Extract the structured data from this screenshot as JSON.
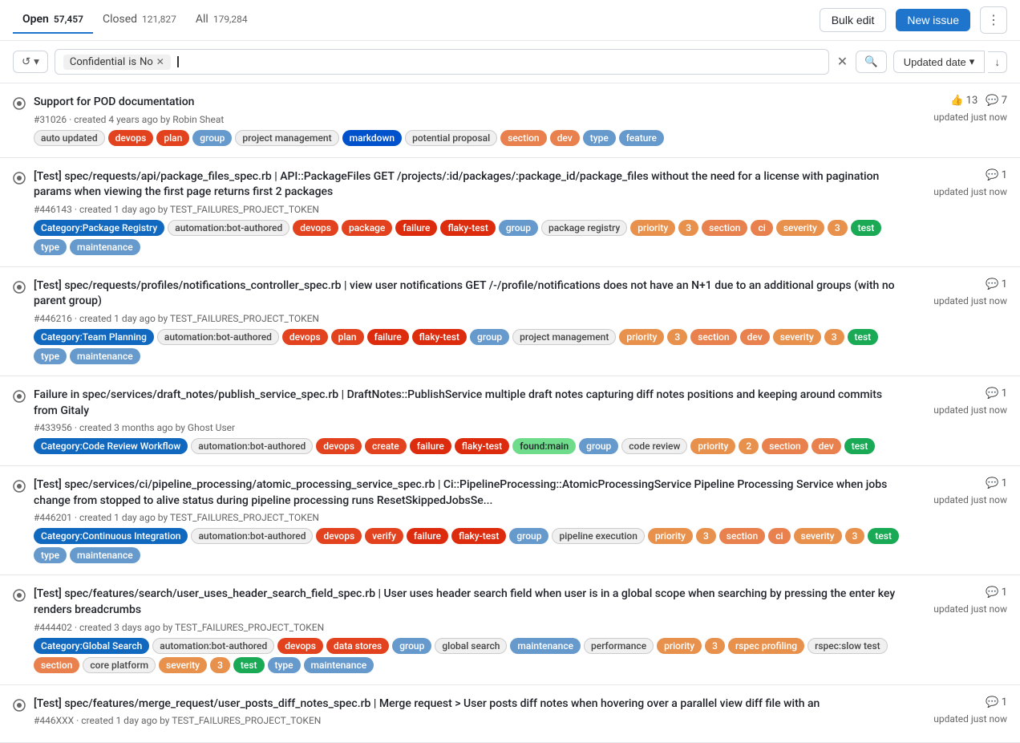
{
  "header": {
    "tabs": [
      {
        "id": "open",
        "label": "Open",
        "count": "57,457",
        "active": true
      },
      {
        "id": "closed",
        "label": "Closed",
        "count": "121,827",
        "active": false
      },
      {
        "id": "all",
        "label": "All",
        "count": "179,284",
        "active": false
      }
    ],
    "bulk_edit_label": "Bulk edit",
    "new_issue_label": "New issue",
    "more_icon": "⋮"
  },
  "filter_bar": {
    "history_icon": "↺",
    "filter_tag_field": "Confidential",
    "filter_tag_operator": "is",
    "filter_tag_value": "No",
    "sort_label": "Updated date",
    "sort_icon": "▼",
    "sort_order_icon": "↓"
  },
  "issues": [
    {
      "id": "issue-1",
      "number": "#31026",
      "title": "Support for POD documentation",
      "meta": "created 4 years ago by Robin Sheat",
      "reactions": [
        {
          "icon": "👍",
          "count": "13"
        },
        {
          "icon": "💬",
          "count": "7"
        }
      ],
      "updated": "updated just now",
      "labels": [
        {
          "text": "auto updated",
          "class": "lbl-auto-updated"
        },
        {
          "text": "devops",
          "class": "lbl-devops"
        },
        {
          "text": "plan",
          "class": "lbl-plan"
        },
        {
          "text": "group",
          "class": "lbl-group"
        },
        {
          "text": "project management",
          "class": "lbl-project-management"
        },
        {
          "text": "markdown",
          "class": "lbl-markdown"
        },
        {
          "text": "potential proposal",
          "class": "lbl-potential-proposal"
        },
        {
          "text": "section",
          "class": "lbl-section"
        },
        {
          "text": "dev",
          "class": "lbl-dev"
        },
        {
          "text": "type",
          "class": "lbl-type"
        },
        {
          "text": "feature",
          "class": "lbl-feature"
        }
      ]
    },
    {
      "id": "issue-2",
      "number": "#446143",
      "title": "[Test] spec/requests/api/package_files_spec.rb | API::PackageFiles GET /projects/:id/packages/:package_id/package_files without the need for a license with pagination params when viewing the first page returns first 2 packages",
      "meta": "created 1 day ago by TEST_FAILURES_PROJECT_TOKEN",
      "reactions": [
        {
          "icon": "💬",
          "count": "1"
        }
      ],
      "updated": "updated just now",
      "labels": [
        {
          "text": "Category:Package Registry",
          "class": "lbl-cat-package"
        },
        {
          "text": "automation:bot-authored",
          "class": "lbl-automation"
        },
        {
          "text": "devops",
          "class": "lbl-devops"
        },
        {
          "text": "package",
          "class": "lbl-package"
        },
        {
          "text": "failure",
          "class": "lbl-failure"
        },
        {
          "text": "flaky-test",
          "class": "lbl-flaky-test"
        },
        {
          "text": "group",
          "class": "lbl-group"
        },
        {
          "text": "package registry",
          "class": "lbl-package-registry"
        },
        {
          "text": "priority",
          "class": "lbl-priority"
        },
        {
          "text": "3",
          "class": "lbl-priority-num"
        },
        {
          "text": "section",
          "class": "lbl-section-ci"
        },
        {
          "text": "ci",
          "class": "lbl-section-ci"
        },
        {
          "text": "severity",
          "class": "lbl-severity"
        },
        {
          "text": "3",
          "class": "lbl-severity-num"
        },
        {
          "text": "test",
          "class": "lbl-test"
        },
        {
          "text": "type",
          "class": "lbl-type"
        },
        {
          "text": "maintenance",
          "class": "lbl-maintenance"
        }
      ]
    },
    {
      "id": "issue-3",
      "number": "#446216",
      "title": "[Test] spec/requests/profiles/notifications_controller_spec.rb | view user notifications GET /-/profile/notifications does not have an N+1 due to an additional groups (with no parent group)",
      "meta": "created 1 day ago by TEST_FAILURES_PROJECT_TOKEN",
      "reactions": [
        {
          "icon": "💬",
          "count": "1"
        }
      ],
      "updated": "updated just now",
      "labels": [
        {
          "text": "Category:Team Planning",
          "class": "lbl-cat-team"
        },
        {
          "text": "automation:bot-authored",
          "class": "lbl-automation"
        },
        {
          "text": "devops",
          "class": "lbl-devops"
        },
        {
          "text": "plan",
          "class": "lbl-plan"
        },
        {
          "text": "failure",
          "class": "lbl-failure"
        },
        {
          "text": "flaky-test",
          "class": "lbl-flaky-test"
        },
        {
          "text": "group",
          "class": "lbl-group"
        },
        {
          "text": "project management",
          "class": "lbl-project-management"
        },
        {
          "text": "priority",
          "class": "lbl-priority"
        },
        {
          "text": "3",
          "class": "lbl-priority-num"
        },
        {
          "text": "section",
          "class": "lbl-section"
        },
        {
          "text": "dev",
          "class": "lbl-dev"
        },
        {
          "text": "severity",
          "class": "lbl-severity"
        },
        {
          "text": "3",
          "class": "lbl-severity-num"
        },
        {
          "text": "test",
          "class": "lbl-test"
        },
        {
          "text": "type",
          "class": "lbl-type"
        },
        {
          "text": "maintenance",
          "class": "lbl-maintenance"
        }
      ]
    },
    {
      "id": "issue-4",
      "number": "#433956",
      "title": "Failure in spec/services/draft_notes/publish_service_spec.rb | DraftNotes::PublishService multiple draft notes capturing diff notes positions and keeping around commits from Gitaly",
      "meta": "created 3 months ago by Ghost User",
      "reactions": [
        {
          "icon": "💬",
          "count": "1"
        }
      ],
      "updated": "updated just now",
      "labels": [
        {
          "text": "Category:Code Review Workflow",
          "class": "lbl-cat-code-review"
        },
        {
          "text": "automation:bot-authored",
          "class": "lbl-automation"
        },
        {
          "text": "devops",
          "class": "lbl-devops"
        },
        {
          "text": "create",
          "class": "lbl-create"
        },
        {
          "text": "failure",
          "class": "lbl-failure"
        },
        {
          "text": "flaky-test",
          "class": "lbl-flaky-test"
        },
        {
          "text": "found:main",
          "class": "lbl-found-main"
        },
        {
          "text": "group",
          "class": "lbl-group"
        },
        {
          "text": "code review",
          "class": "lbl-code-review"
        },
        {
          "text": "priority",
          "class": "lbl-priority"
        },
        {
          "text": "2",
          "class": "lbl-priority-num"
        },
        {
          "text": "section",
          "class": "lbl-section"
        },
        {
          "text": "dev",
          "class": "lbl-dev"
        },
        {
          "text": "test",
          "class": "lbl-test"
        }
      ]
    },
    {
      "id": "issue-5",
      "number": "#446201",
      "title": "[Test] spec/services/ci/pipeline_processing/atomic_processing_service_spec.rb | Ci::PipelineProcessing::AtomicProcessingService Pipeline Processing Service when jobs change from stopped to alive status during pipeline processing runs ResetSkippedJobsSe...",
      "meta": "created 1 day ago by TEST_FAILURES_PROJECT_TOKEN",
      "reactions": [
        {
          "icon": "💬",
          "count": "1"
        }
      ],
      "updated": "updated just now",
      "labels": [
        {
          "text": "Category:Continuous Integration",
          "class": "lbl-cat-ci"
        },
        {
          "text": "automation:bot-authored",
          "class": "lbl-automation"
        },
        {
          "text": "devops",
          "class": "lbl-devops"
        },
        {
          "text": "verify",
          "class": "lbl-verify"
        },
        {
          "text": "failure",
          "class": "lbl-failure"
        },
        {
          "text": "flaky-test",
          "class": "lbl-flaky-test"
        },
        {
          "text": "group",
          "class": "lbl-group"
        },
        {
          "text": "pipeline execution",
          "class": "lbl-pipeline-execution"
        },
        {
          "text": "priority",
          "class": "lbl-priority"
        },
        {
          "text": "3",
          "class": "lbl-priority-num"
        },
        {
          "text": "section",
          "class": "lbl-section-ci"
        },
        {
          "text": "ci",
          "class": "lbl-section-ci"
        },
        {
          "text": "severity",
          "class": "lbl-severity"
        },
        {
          "text": "3",
          "class": "lbl-severity-num"
        },
        {
          "text": "test",
          "class": "lbl-test"
        },
        {
          "text": "type",
          "class": "lbl-type"
        },
        {
          "text": "maintenance",
          "class": "lbl-maintenance"
        }
      ]
    },
    {
      "id": "issue-6",
      "number": "#444402",
      "title": "[Test] spec/features/search/user_uses_header_search_field_spec.rb | User uses header search field when user is in a global scope when searching by pressing the enter key renders breadcrumbs",
      "meta": "created 3 days ago by TEST_FAILURES_PROJECT_TOKEN",
      "reactions": [
        {
          "icon": "💬",
          "count": "1"
        }
      ],
      "updated": "updated just now",
      "labels": [
        {
          "text": "Category:Global Search",
          "class": "lbl-cat-global"
        },
        {
          "text": "automation:bot-authored",
          "class": "lbl-automation"
        },
        {
          "text": "devops",
          "class": "lbl-devops"
        },
        {
          "text": "data stores",
          "class": "lbl-data-stores"
        },
        {
          "text": "group",
          "class": "lbl-group"
        },
        {
          "text": "global search",
          "class": "lbl-global-search"
        },
        {
          "text": "maintenance",
          "class": "lbl-maint"
        },
        {
          "text": "performance",
          "class": "lbl-performance"
        },
        {
          "text": "priority",
          "class": "lbl-priority"
        },
        {
          "text": "3",
          "class": "lbl-priority-num"
        },
        {
          "text": "rspec profiling",
          "class": "lbl-rspec-profiling"
        },
        {
          "text": "rspec:slow test",
          "class": "lbl-rspec-slow"
        },
        {
          "text": "section",
          "class": "lbl-section"
        },
        {
          "text": "core platform",
          "class": "lbl-core-platform"
        },
        {
          "text": "severity",
          "class": "lbl-severity"
        },
        {
          "text": "3",
          "class": "lbl-severity-num"
        },
        {
          "text": "test",
          "class": "lbl-test"
        },
        {
          "text": "type",
          "class": "lbl-type"
        },
        {
          "text": "maintenance",
          "class": "lbl-maintenance"
        }
      ]
    },
    {
      "id": "issue-7",
      "number": "#446XXX",
      "title": "[Test] spec/features/merge_request/user_posts_diff_notes_spec.rb | Merge request > User posts diff notes when hovering over a parallel view diff file with an",
      "meta": "created 1 day ago by TEST_FAILURES_PROJECT_TOKEN",
      "reactions": [
        {
          "icon": "💬",
          "count": "1"
        }
      ],
      "updated": "updated just now",
      "labels": []
    }
  ]
}
